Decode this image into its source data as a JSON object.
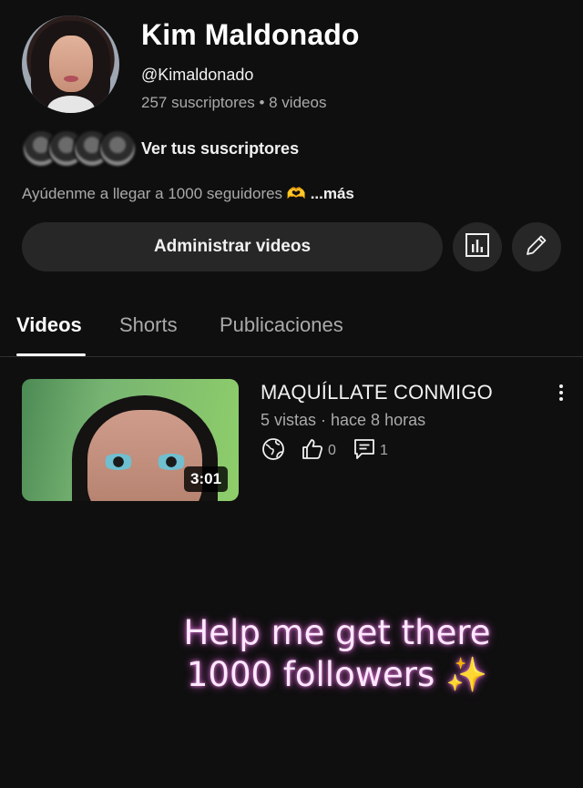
{
  "channel": {
    "name": "Kim Maldonado",
    "handle": "@Kimaldonado",
    "stats": "257 suscriptores • 8 videos",
    "view_subscribers_label": "Ver tus suscriptores",
    "description": "Ayúdenme a llegar a 1000 seguidores 🫶",
    "description_more": "...más"
  },
  "actions": {
    "manage_videos_label": "Administrar videos",
    "analytics_icon": "bar-chart-icon",
    "edit_icon": "pencil-icon"
  },
  "tabs": [
    {
      "label": "Videos",
      "active": true
    },
    {
      "label": "Shorts",
      "active": false
    },
    {
      "label": "Publicaciones",
      "active": false
    }
  ],
  "videos": [
    {
      "title": "MAQUÍLLATE CONMIGO",
      "meta": "5 vistas · hace 8 horas",
      "duration": "3:01",
      "likes": "0",
      "comments": "1",
      "visibility_icon": "globe-icon"
    }
  ],
  "overlay": {
    "line1": "Help me get there",
    "line2": "1000 followers ✨"
  },
  "colors": {
    "background": "#0f0f0f",
    "button_bg": "#272727",
    "secondary_text": "#aaaaaa",
    "promo_glow": "#e07ad6"
  }
}
